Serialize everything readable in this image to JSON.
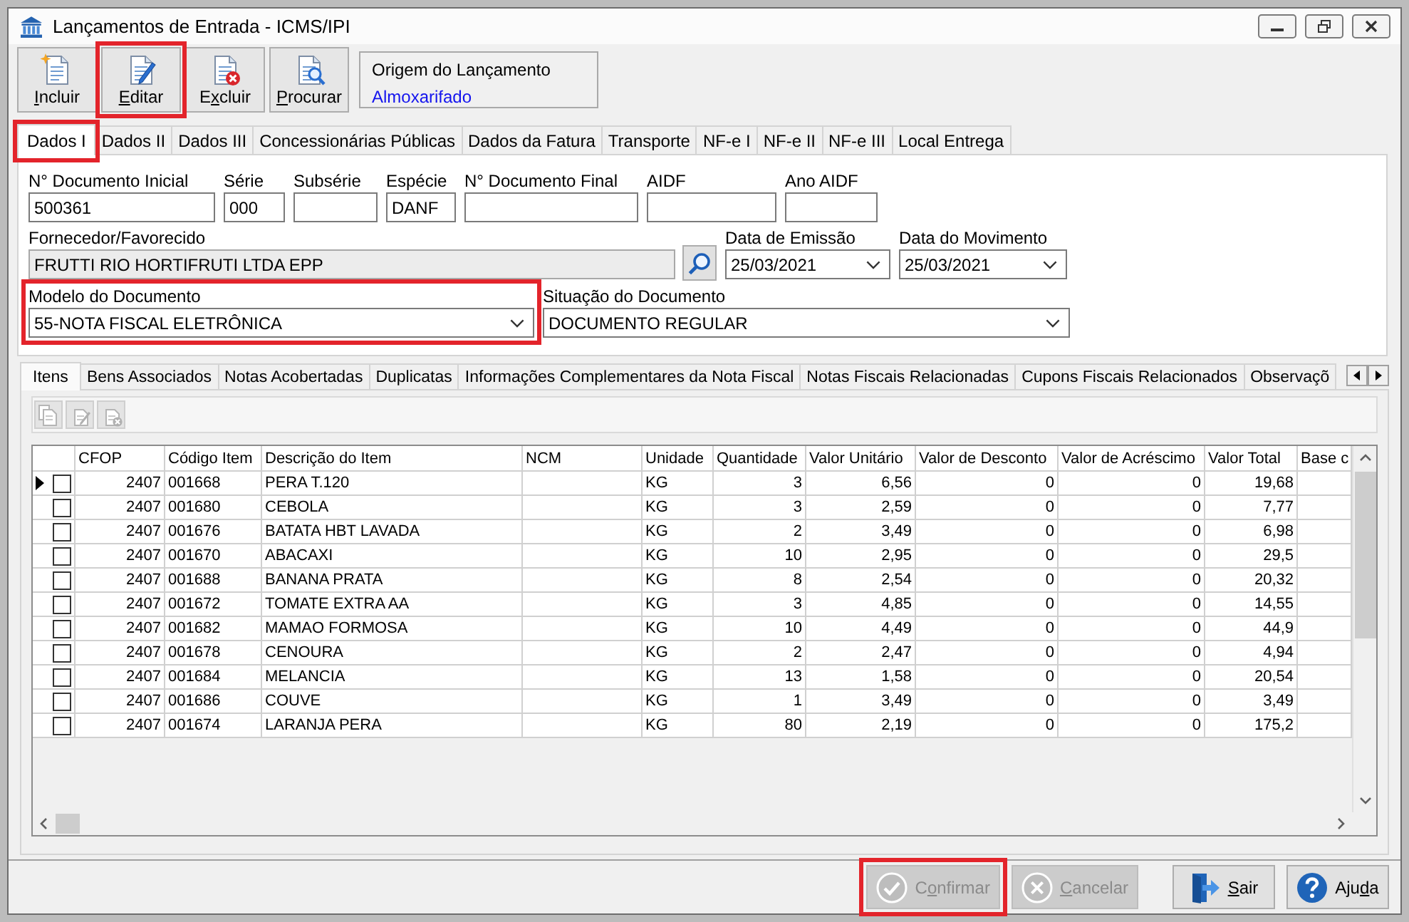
{
  "window": {
    "title": "Lançamentos de Entrada - ICMS/IPI"
  },
  "toolbar": {
    "buttons": [
      {
        "kind": "new",
        "accel": "I",
        "post": "ncluir",
        "highlighted": false
      },
      {
        "kind": "edit",
        "accel": "E",
        "post": "ditar",
        "highlighted": true
      },
      {
        "kind": "delete",
        "pre": "E",
        "accel": "x",
        "post": "cluir",
        "highlighted": false
      },
      {
        "kind": "search",
        "accel": "P",
        "post": "rocurar",
        "highlighted": false
      }
    ],
    "origin": {
      "title": "Origem do Lançamento",
      "value": "Almoxarifado"
    }
  },
  "main_tabs": [
    {
      "label": "Dados I",
      "selected": true,
      "highlighted": true
    },
    {
      "label": "Dados II",
      "selected": false,
      "highlighted": false
    },
    {
      "label": "Dados III",
      "selected": false,
      "highlighted": false
    },
    {
      "label": "Concessionárias Públicas",
      "selected": false,
      "highlighted": false
    },
    {
      "label": "Dados da Fatura",
      "selected": false,
      "highlighted": false
    },
    {
      "label": "Transporte",
      "selected": false,
      "highlighted": false
    },
    {
      "label": "NF-e I",
      "selected": false,
      "highlighted": false
    },
    {
      "label": "NF-e II",
      "selected": false,
      "highlighted": false
    },
    {
      "label": "NF-e III",
      "selected": false,
      "highlighted": false
    },
    {
      "label": "Local Entrega",
      "selected": false,
      "highlighted": false
    }
  ],
  "form": {
    "fields": [
      {
        "label": "N° Documento Inicial",
        "kind": "text",
        "value": "500361",
        "readonly": false,
        "highlighted": false
      },
      {
        "label": "Série",
        "kind": "text",
        "value": "000",
        "readonly": false,
        "highlighted": false
      },
      {
        "label": "Subsérie",
        "kind": "text",
        "readonly": false,
        "highlighted": false
      },
      {
        "label": "Espécie",
        "kind": "text",
        "value": "DANF",
        "readonly": false,
        "highlighted": false
      },
      {
        "label": "N° Documento Final",
        "kind": "text",
        "readonly": false,
        "highlighted": false
      },
      {
        "label": "AIDF",
        "kind": "text",
        "readonly": false,
        "highlighted": false
      },
      {
        "label": "Ano AIDF",
        "kind": "text",
        "readonly": false,
        "highlighted": false
      },
      {
        "label": "Fornecedor/Favorecido",
        "kind": "lookup",
        "value": "FRUTTI RIO HORTIFRUTI LTDA EPP",
        "readonly": true,
        "highlighted": false
      },
      {
        "label": "Data de Emissão",
        "kind": "select",
        "value": "25/03/2021",
        "readonly": false,
        "highlighted": false
      },
      {
        "label": "Data do Movimento",
        "kind": "select",
        "value": "25/03/2021",
        "readonly": false,
        "highlighted": false
      },
      {
        "label": "Modelo do Documento",
        "kind": "select",
        "value": "55-NOTA FISCAL ELETRÔNICA",
        "readonly": false,
        "highlighted": true
      },
      {
        "label": "Situação do Documento",
        "kind": "select",
        "value": "DOCUMENTO REGULAR",
        "readonly": false,
        "highlighted": false
      }
    ]
  },
  "item_tabs": [
    {
      "label": "Itens",
      "selected": true
    },
    {
      "label": "Bens Associados",
      "selected": false
    },
    {
      "label": "Notas Acobertadas",
      "selected": false
    },
    {
      "label": "Duplicatas",
      "selected": false
    },
    {
      "label": "Informações Complementares da Nota Fiscal",
      "selected": false
    },
    {
      "label": "Notas Fiscais Relacionadas",
      "selected": false
    },
    {
      "label": "Cupons Fiscais Relacionados",
      "selected": false
    },
    {
      "label": "Observaçõ",
      "selected": false
    }
  ],
  "items_toolbar": [
    {
      "kind": "add",
      "disabled": true
    },
    {
      "kind": "edit",
      "disabled": true
    },
    {
      "kind": "delete",
      "disabled": true
    }
  ],
  "grid": {
    "columns": [
      "CFOP",
      "Código Item",
      "Descrição do Item",
      "NCM",
      "Unidade",
      "Quantidade",
      "Valor Unitário",
      "Valor de Desconto",
      "Valor de Acréscimo",
      "Valor Total",
      "Base c"
    ],
    "rows": [
      {
        "current": true,
        "checked": false,
        "cells": [
          "2407",
          "001668",
          "PERA T.120",
          null,
          "KG",
          "3",
          "6,56",
          "0",
          "0",
          "19,68"
        ]
      },
      {
        "current": false,
        "checked": false,
        "cells": [
          "2407",
          "001680",
          "CEBOLA",
          null,
          "KG",
          "3",
          "2,59",
          "0",
          "0",
          "7,77"
        ]
      },
      {
        "current": false,
        "checked": false,
        "cells": [
          "2407",
          "001676",
          "BATATA HBT LAVADA",
          null,
          "KG",
          "2",
          "3,49",
          "0",
          "0",
          "6,98"
        ]
      },
      {
        "current": false,
        "checked": false,
        "cells": [
          "2407",
          "001670",
          "ABACAXI",
          null,
          "KG",
          "10",
          "2,95",
          "0",
          "0",
          "29,5"
        ]
      },
      {
        "current": false,
        "checked": false,
        "cells": [
          "2407",
          "001688",
          "BANANA PRATA",
          null,
          "KG",
          "8",
          "2,54",
          "0",
          "0",
          "20,32"
        ]
      },
      {
        "current": false,
        "checked": false,
        "cells": [
          "2407",
          "001672",
          "TOMATE EXTRA AA",
          null,
          "KG",
          "3",
          "4,85",
          "0",
          "0",
          "14,55"
        ]
      },
      {
        "current": false,
        "checked": false,
        "cells": [
          "2407",
          "001682",
          "MAMAO FORMOSA",
          null,
          "KG",
          "10",
          "4,49",
          "0",
          "0",
          "44,9"
        ]
      },
      {
        "current": false,
        "checked": false,
        "cells": [
          "2407",
          "001678",
          "CENOURA",
          null,
          "KG",
          "2",
          "2,47",
          "0",
          "0",
          "4,94"
        ]
      },
      {
        "current": false,
        "checked": false,
        "cells": [
          "2407",
          "001684",
          "MELANCIA",
          null,
          "KG",
          "13",
          "1,58",
          "0",
          "0",
          "20,54"
        ]
      },
      {
        "current": false,
        "checked": false,
        "cells": [
          "2407",
          "001686",
          "COUVE",
          null,
          "KG",
          "1",
          "3,49",
          "0",
          "0",
          "3,49"
        ]
      },
      {
        "current": false,
        "checked": false,
        "cells": [
          "2407",
          "001674",
          "LARANJA PERA",
          null,
          "KG",
          "80",
          "2,19",
          "0",
          "0",
          "175,2"
        ]
      }
    ]
  },
  "footer_buttons": [
    {
      "kind": "confirm",
      "pre": "C",
      "accel": "o",
      "post": "nfirmar",
      "disabled": true,
      "highlighted": true
    },
    {
      "kind": "cancel",
      "accel": "C",
      "post": "ancelar",
      "disabled": true,
      "highlighted": false
    },
    {
      "kind": "exit",
      "accel": "S",
      "post": "air",
      "disabled": false,
      "highlighted": false
    },
    {
      "kind": "help",
      "pre": "Aju",
      "accel": "d",
      "post": "a",
      "disabled": false,
      "highlighted": false
    }
  ]
}
